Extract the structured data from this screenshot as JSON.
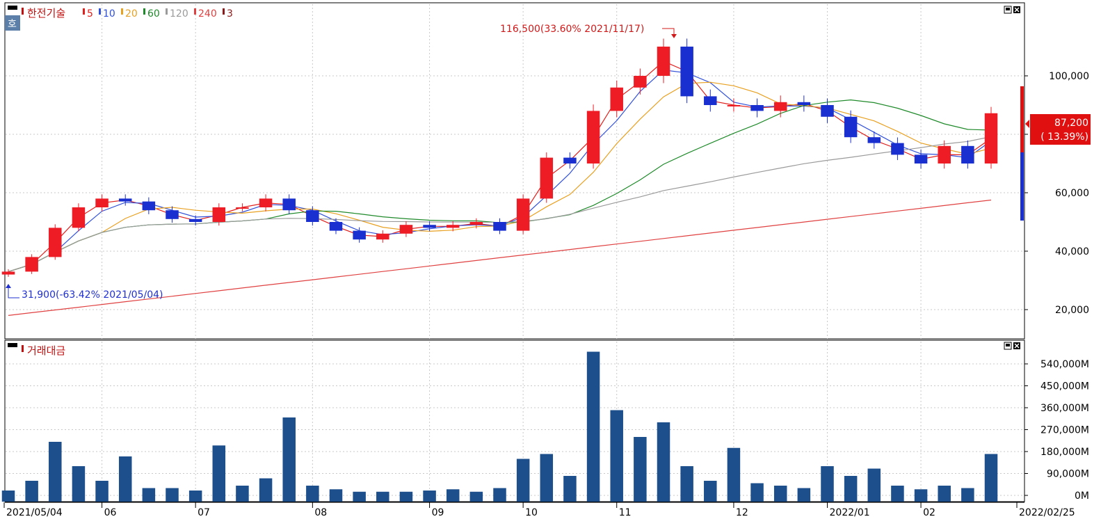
{
  "header": {
    "stock_name": "한전기술",
    "side_badge": "호",
    "ma_legend": [
      {
        "label": "5",
        "color": "#e0201c"
      },
      {
        "label": "10",
        "color": "#2f4fd8"
      },
      {
        "label": "20",
        "color": "#e8a020"
      },
      {
        "label": "60",
        "color": "#1f8a2a"
      },
      {
        "label": "120",
        "color": "#9a9a9a"
      },
      {
        "label": "240",
        "color": "#e04040"
      },
      {
        "label": "3",
        "color": "#8b1a1a"
      }
    ]
  },
  "price_panel": {
    "high_annotation": "116,500(33.60% 2021/11/17)",
    "low_annotation": "31,900(-63.42% 2021/05/04)",
    "current_price": "87,200",
    "current_change": "( 13.39%)",
    "y_labels": [
      "100,000",
      "80,000",
      "60,000",
      "40,000",
      "20,000"
    ]
  },
  "volume_panel": {
    "title": "거래대금",
    "y_labels": [
      "540,000M",
      "450,000M",
      "360,000M",
      "270,000M",
      "180,000M",
      "90,000M",
      "0M"
    ]
  },
  "x_axis": {
    "labels": [
      "2021/05/04",
      "06",
      "07",
      "08",
      "09",
      "10",
      "11",
      "12",
      "2022/01",
      "02",
      "2022/02/25"
    ]
  },
  "colors": {
    "up": "#ee1c25",
    "down": "#1a2fd0",
    "volume": "#1d4f8c",
    "grid": "#c8c8c8"
  },
  "chart_data": [
    {
      "type": "candlestick",
      "title": "한전기술",
      "series_note": "moving averages 5, 10, 20, 60, 120, 240",
      "x": [
        "2021/05/04",
        "2021/05/11",
        "2021/05/18",
        "2021/05/25",
        "2021/06/01",
        "2021/06/08",
        "2021/06/15",
        "2021/06/22",
        "2021/06/29",
        "2021/07/06",
        "2021/07/13",
        "2021/07/20",
        "2021/07/27",
        "2021/08/03",
        "2021/08/10",
        "2021/08/17",
        "2021/08/24",
        "2021/08/31",
        "2021/09/07",
        "2021/09/14",
        "2021/09/24",
        "2021/10/01",
        "2021/10/08",
        "2021/10/15",
        "2021/10/22",
        "2021/10/29",
        "2021/11/05",
        "2021/11/12",
        "2021/11/17",
        "2021/11/24",
        "2021/12/01",
        "2021/12/08",
        "2021/12/15",
        "2021/12/22",
        "2021/12/29",
        "2022/01/05",
        "2022/01/12",
        "2022/01/19",
        "2022/01/26",
        "2022/02/04",
        "2022/02/11",
        "2022/02/18",
        "2022/02/25"
      ],
      "close": [
        33000,
        38000,
        48000,
        55000,
        58000,
        57000,
        54000,
        51000,
        50000,
        55000,
        55000,
        58000,
        54000,
        50000,
        47000,
        44000,
        46000,
        49000,
        48000,
        49000,
        50000,
        47000,
        58000,
        72000,
        70000,
        88000,
        96000,
        100000,
        110000,
        93000,
        90000,
        90000,
        88000,
        91000,
        90000,
        86000,
        79000,
        77000,
        73000,
        70000,
        76000,
        70000,
        87200
      ],
      "ylim": [
        10000,
        125000
      ],
      "y_ticks": [
        20000,
        40000,
        60000,
        80000,
        100000
      ],
      "high": 116500,
      "low": 31900
    },
    {
      "type": "bar",
      "title": "거래대금",
      "unit": "M",
      "x": [
        "2021/05/04",
        "2021/05/11",
        "2021/05/18",
        "2021/05/25",
        "2021/06/01",
        "2021/06/08",
        "2021/06/15",
        "2021/06/22",
        "2021/06/29",
        "2021/07/06",
        "2021/07/13",
        "2021/07/20",
        "2021/07/27",
        "2021/08/03",
        "2021/08/10",
        "2021/08/17",
        "2021/08/24",
        "2021/08/31",
        "2021/09/07",
        "2021/09/14",
        "2021/09/24",
        "2021/10/01",
        "2021/10/08",
        "2021/10/15",
        "2021/10/22",
        "2021/10/29",
        "2021/11/05",
        "2021/11/12",
        "2021/11/17",
        "2021/11/24",
        "2021/12/01",
        "2021/12/08",
        "2021/12/15",
        "2021/12/22",
        "2021/12/29",
        "2022/01/05",
        "2022/01/12",
        "2022/01/19",
        "2022/01/26",
        "2022/02/04",
        "2022/02/11",
        "2022/02/18",
        "2022/02/25"
      ],
      "values": [
        20000,
        60000,
        220000,
        120000,
        60000,
        160000,
        30000,
        30000,
        20000,
        205000,
        40000,
        70000,
        320000,
        40000,
        25000,
        15000,
        15000,
        15000,
        20000,
        25000,
        15000,
        30000,
        150000,
        170000,
        80000,
        590000,
        350000,
        240000,
        300000,
        120000,
        60000,
        195000,
        50000,
        40000,
        30000,
        120000,
        80000,
        110000,
        40000,
        25000,
        40000,
        30000,
        170000
      ],
      "ylim": [
        0,
        600000
      ],
      "y_ticks": [
        0,
        90000,
        180000,
        270000,
        360000,
        450000,
        540000
      ]
    }
  ]
}
